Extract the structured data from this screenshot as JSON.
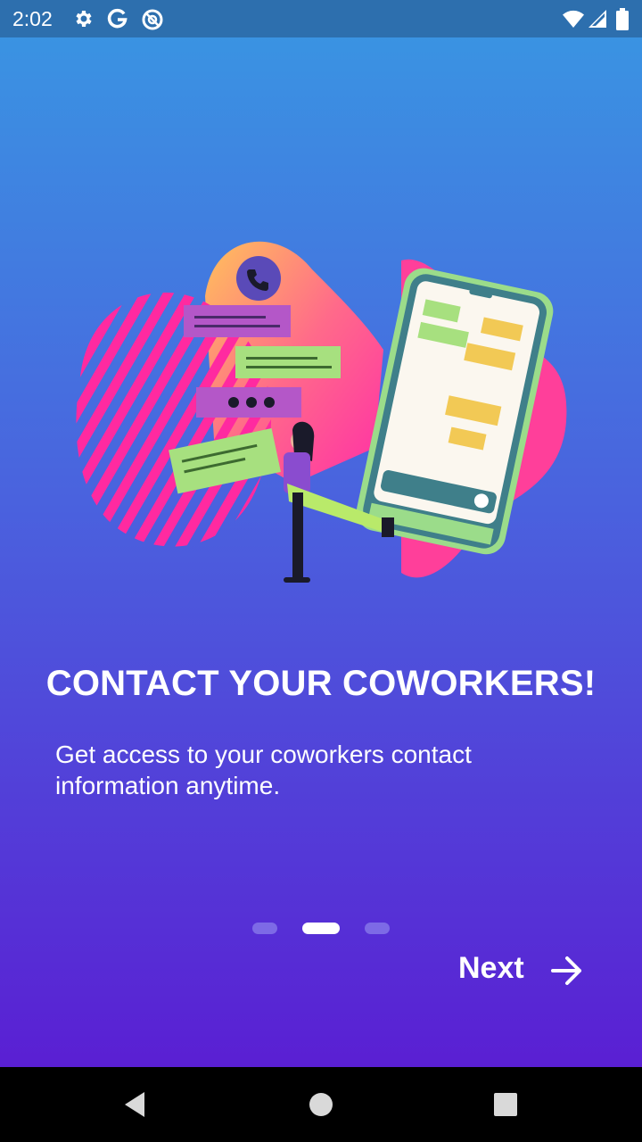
{
  "status_bar": {
    "time": "2:02",
    "icons": [
      "settings-icon",
      "google-icon",
      "no-disturb-icon",
      "wifi-icon",
      "signal-icon",
      "battery-icon"
    ]
  },
  "onboarding": {
    "illustration": "woman-texting-phone-illustration",
    "title": "CONTACT YOUR COWORKERS!",
    "description": "Get access to your coworkers contact information anytime.",
    "page_indicator": {
      "count": 3,
      "active_index": 1
    },
    "next_label": "Next"
  },
  "nav_bar": {
    "buttons": [
      "back",
      "home",
      "recents"
    ]
  },
  "colors": {
    "gradient_top": "#3a93e2",
    "gradient_bottom": "#5a1fd3",
    "status_bar": "#2d6fae",
    "dot_inactive": "#7d6ae6",
    "dot_active": "#ffffff"
  }
}
